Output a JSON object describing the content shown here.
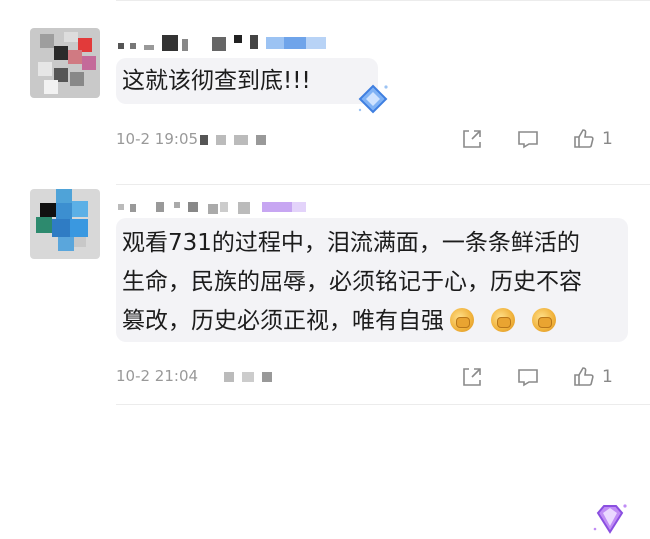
{
  "comments": [
    {
      "text_lines": [
        "这就该彻查到底!!!"
      ],
      "time": "10-2 19:05",
      "like_count": "1"
    },
    {
      "text_lines": [
        "观看731的过程中，泪流满面，一条条鲜活的",
        "生命，民族的屈辱，必须铭记于心，历史不容",
        "篡改，历史必须正视，唯有自强"
      ],
      "time": "10-2 21:04",
      "like_count": "1"
    }
  ],
  "icons": {
    "share": "share-icon",
    "comment": "comment-icon",
    "like": "thumbs-up-icon"
  },
  "colors": {
    "bubble": "#f3f3f6",
    "meta_text": "#999999",
    "badge_blue": "#4a8ef0",
    "badge_purple": "#a56bf0"
  }
}
